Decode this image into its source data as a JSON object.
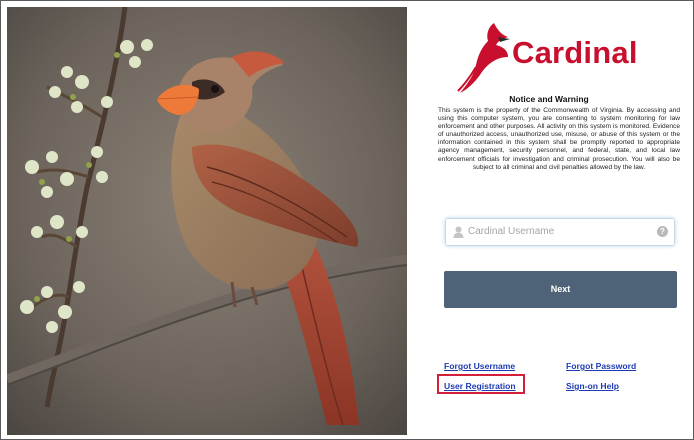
{
  "brand": {
    "name": "Cardinal",
    "accent_color": "#c8102e"
  },
  "notice": {
    "title": "Notice and Warning",
    "body": "This system is the property of the Commonwealth of Virginia. By accessing and using this computer system, you are consenting to system monitoring for law enforcement and other purposes. All activity on this system is monitored. Evidence of unauthorized access, unauthorized use, misuse, or abuse of this system or the information contained in this system shall be promptly reported to appropriate agency management, security personnel, and federal, state, and local law enforcement officials for investigation and criminal prosecution. You will also be subject to all criminal and civil penalties allowed by the law."
  },
  "login": {
    "username_placeholder": "Cardinal Username",
    "username_value": "",
    "help_symbol": "?",
    "next_label": "Next",
    "button_color": "#4e6377"
  },
  "links": {
    "forgot_username": "Forgot Username",
    "forgot_password": "Forgot Password",
    "user_registration": "User Registration",
    "signon_help": "Sign-on Help",
    "highlight_color": "#d21f3c"
  },
  "image": {
    "subject": "cardinal-bird-photo"
  }
}
